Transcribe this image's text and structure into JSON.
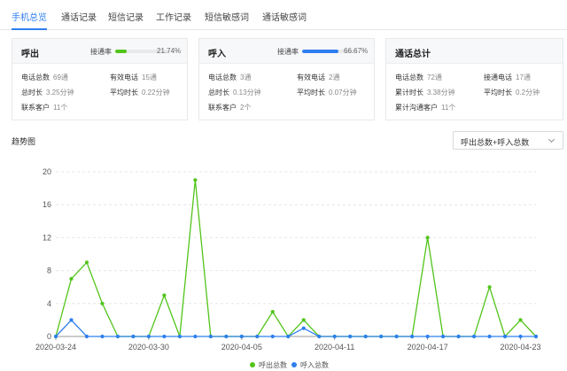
{
  "tabs": [
    {
      "label": "手机总览",
      "active": true
    },
    {
      "label": "通话记录",
      "active": false
    },
    {
      "label": "短信记录",
      "active": false
    },
    {
      "label": "工作记录",
      "active": false
    },
    {
      "label": "短信敏感词",
      "active": false
    },
    {
      "label": "通话敏感词",
      "active": false
    }
  ],
  "cards": {
    "outgoing": {
      "title": "呼出",
      "rate_label": "接通率",
      "rate_value": "21.74%",
      "rate_fraction": 0.2174,
      "rate_color": "#52c41a",
      "stats": [
        {
          "label": "电话总数",
          "value": "69通"
        },
        {
          "label": "有效电话",
          "value": "15通"
        },
        {
          "label": "总时长",
          "value": "3.25分钟"
        },
        {
          "label": "平均时长",
          "value": "0.22分钟"
        },
        {
          "label": "联系客户",
          "value": "11个"
        }
      ]
    },
    "incoming": {
      "title": "呼入",
      "rate_label": "接通率",
      "rate_value": "66.67%",
      "rate_fraction": 0.6667,
      "rate_color": "#2f7ff0",
      "stats": [
        {
          "label": "电话总数",
          "value": "3通"
        },
        {
          "label": "有效电话",
          "value": "2通"
        },
        {
          "label": "总时长",
          "value": "0.13分钟"
        },
        {
          "label": "平均时长",
          "value": "0.07分钟"
        },
        {
          "label": "联系客户",
          "value": "2个"
        }
      ]
    },
    "total": {
      "title": "通话总计",
      "stats": [
        {
          "label": "电话总数",
          "value": "72通"
        },
        {
          "label": "接通电话",
          "value": "17通"
        },
        {
          "label": "累计时长",
          "value": "3.38分钟"
        },
        {
          "label": "平均时长",
          "value": "0.2分钟"
        },
        {
          "label": "累计沟通客户",
          "value": "11个"
        }
      ]
    }
  },
  "trend": {
    "title": "趋势图",
    "select_value": "呼出总数+呼入总数",
    "select_icon": "chevron-down-icon"
  },
  "chart_data": {
    "type": "line",
    "x": [
      "2020-03-24",
      "2020-03-25",
      "2020-03-26",
      "2020-03-27",
      "2020-03-28",
      "2020-03-29",
      "2020-03-30",
      "2020-03-31",
      "2020-04-01",
      "2020-04-02",
      "2020-04-03",
      "2020-04-04",
      "2020-04-05",
      "2020-04-06",
      "2020-04-07",
      "2020-04-08",
      "2020-04-09",
      "2020-04-10",
      "2020-04-11",
      "2020-04-12",
      "2020-04-13",
      "2020-04-14",
      "2020-04-15",
      "2020-04-16",
      "2020-04-17",
      "2020-04-18",
      "2020-04-19",
      "2020-04-20",
      "2020-04-21",
      "2020-04-22",
      "2020-04-23",
      "2020-04-24"
    ],
    "x_tick_labels": [
      "2020-03-24",
      "2020-03-30",
      "2020-04-05",
      "2020-04-11",
      "2020-04-17",
      "2020-04-23"
    ],
    "x_tick_dates": [
      "2020-03-24",
      "2020-03-30",
      "2020-04-05",
      "2020-04-11",
      "2020-04-17",
      "2020-04-23"
    ],
    "ylim": [
      0,
      20
    ],
    "y_ticks": [
      0,
      4,
      8,
      12,
      16,
      20
    ],
    "grid": "horizontal-dashed",
    "legend_position": "bottom-center",
    "series": [
      {
        "name": "呼出总数",
        "color": "#52c41a",
        "values": [
          0,
          7,
          9,
          4,
          0,
          0,
          0,
          5,
          0,
          19,
          0,
          0,
          0,
          0,
          3,
          0,
          2,
          0,
          0,
          0,
          0,
          0,
          0,
          0,
          12,
          0,
          0,
          0,
          6,
          0,
          2,
          0
        ]
      },
      {
        "name": "呼入总数",
        "color": "#2f7ff0",
        "values": [
          0,
          2,
          0,
          0,
          0,
          0,
          0,
          0,
          0,
          0,
          0,
          0,
          0,
          0,
          0,
          0,
          1,
          0,
          0,
          0,
          0,
          0,
          0,
          0,
          0,
          0,
          0,
          0,
          0,
          0,
          0,
          0
        ]
      }
    ]
  }
}
